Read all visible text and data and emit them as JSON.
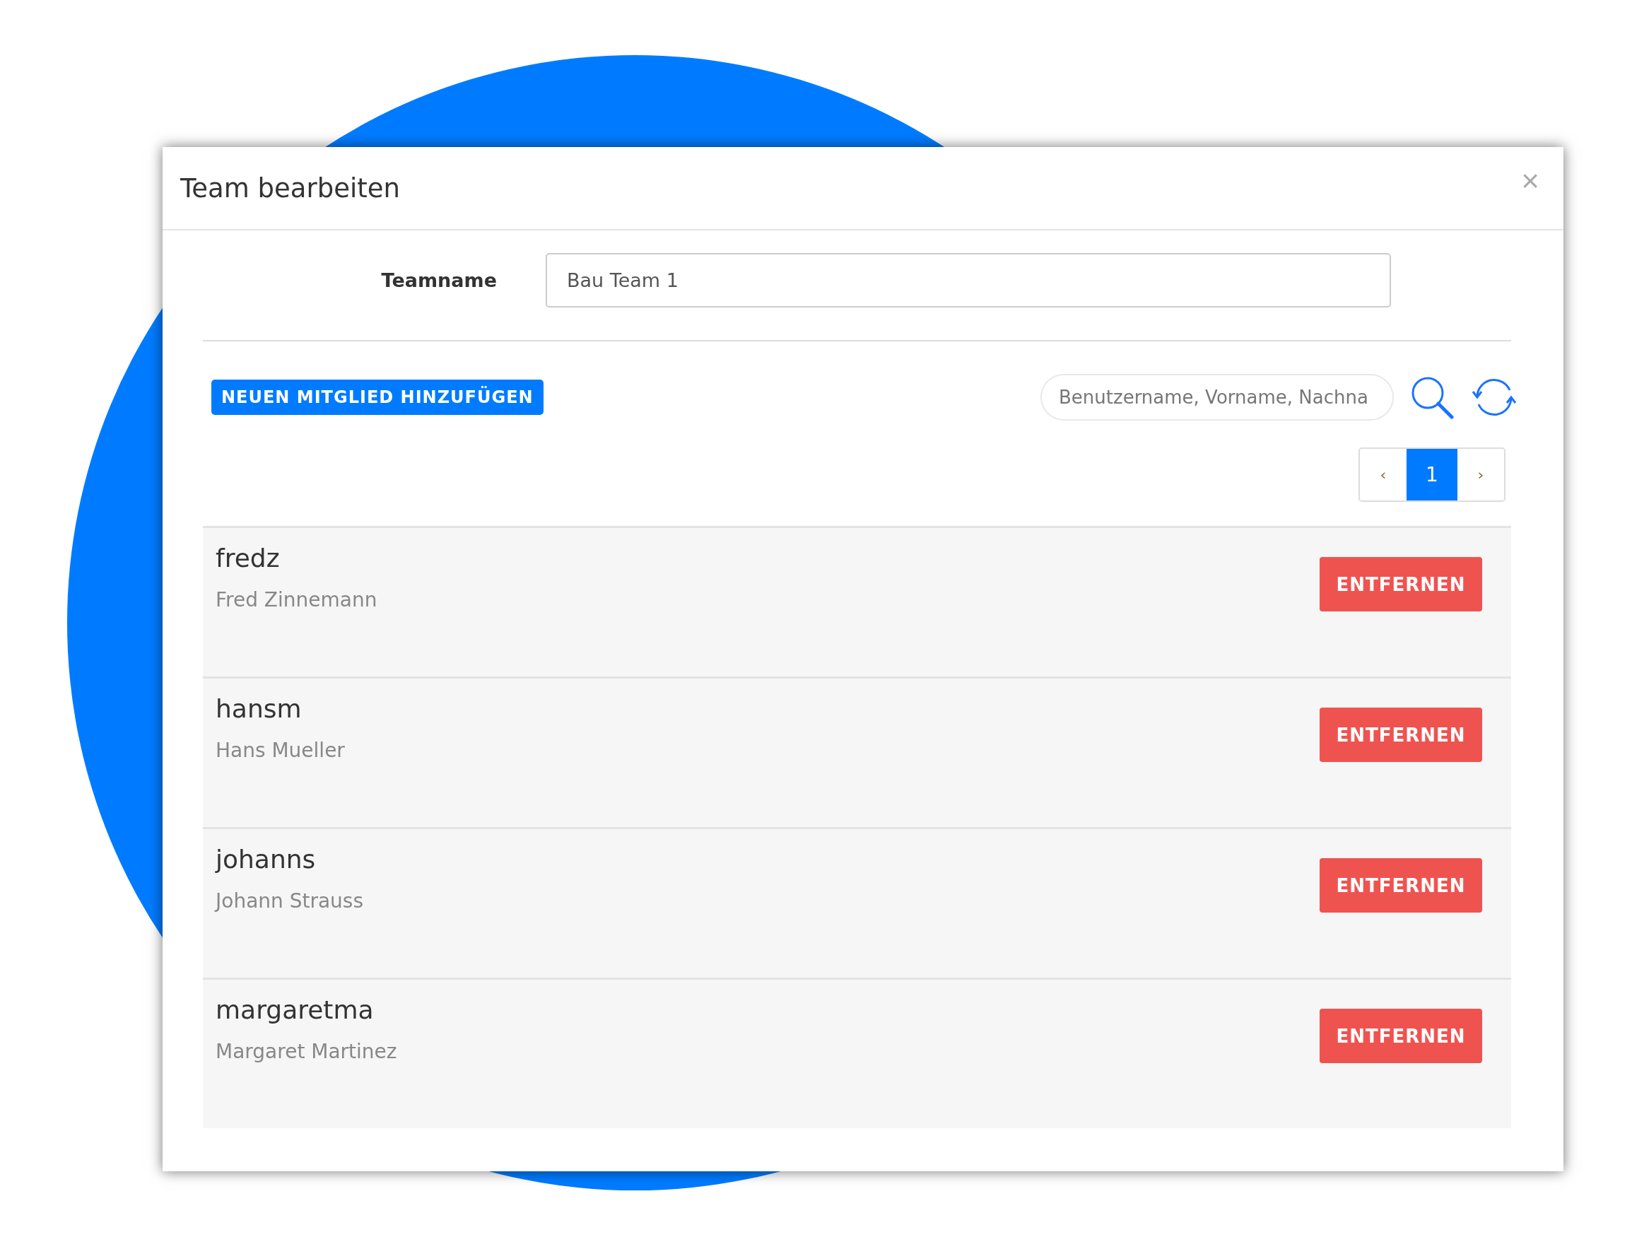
{
  "dialog": {
    "title": "Team bearbeiten",
    "close": "×"
  },
  "form": {
    "label": "Teamname",
    "value": "Bau Team 1"
  },
  "toolbar": {
    "add_button": "NEUEN MITGLIED HINZUFÜGEN",
    "search": {
      "placeholder": "Benutzername, Vorname, Nachna"
    }
  },
  "pagination": [
    {
      "label": "‹",
      "kind": "prev",
      "selected": false
    },
    {
      "label": "1",
      "kind": "page",
      "selected": true
    },
    {
      "label": "›",
      "kind": "next",
      "selected": false
    }
  ],
  "members": [
    {
      "username": "fredz",
      "name": "Fred Zinnemann",
      "action": "ENTFERNEN"
    },
    {
      "username": "hansm",
      "name": "Hans Mueller",
      "action": "ENTFERNEN"
    },
    {
      "username": "johanns",
      "name": "Johann Strauss",
      "action": "ENTFERNEN"
    },
    {
      "username": "margaretma",
      "name": "Margaret Martinez",
      "action": "ENTFERNEN"
    }
  ]
}
